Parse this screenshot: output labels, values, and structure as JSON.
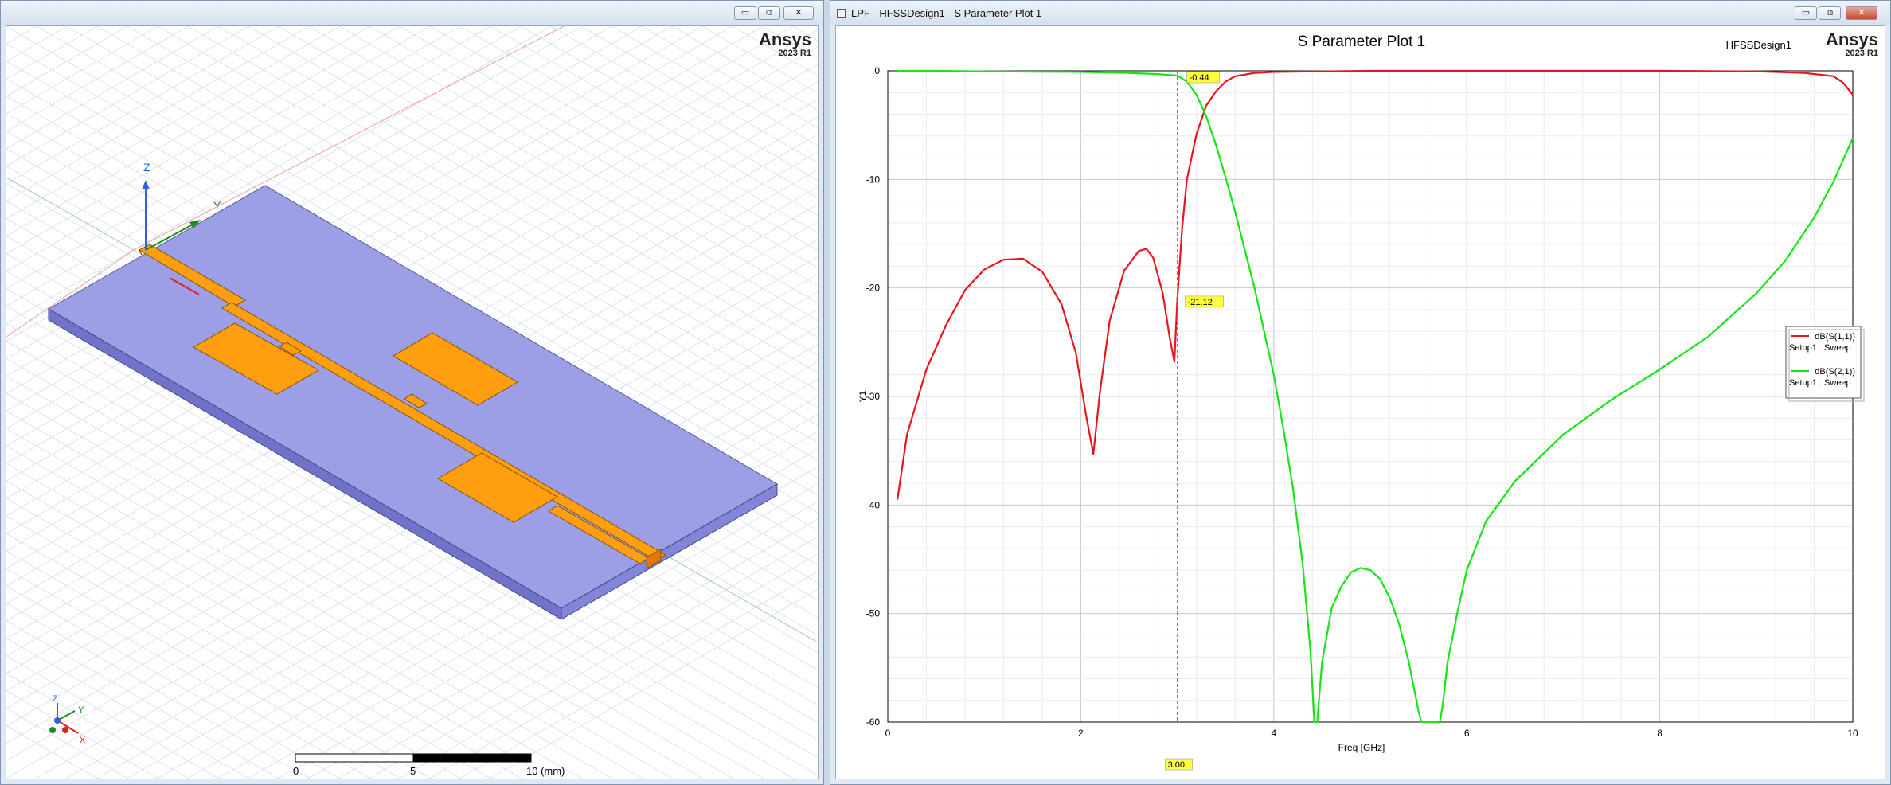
{
  "left_window": {
    "controls": {
      "minimize": "▭",
      "restore": "⧉",
      "close": "✕"
    },
    "logo": {
      "name": "Ansys",
      "version": "2023 R1"
    },
    "axes": {
      "z": "Z",
      "y": "Y"
    },
    "mini_axes": {
      "z": "Z",
      "y": "Y",
      "x": "X"
    },
    "scale_bar": {
      "tick0": "0",
      "tick1": "5",
      "tick2": "10 (mm)"
    },
    "colors": {
      "substrate": "#9c9ee6",
      "metal": "#ff9f10",
      "grid": "#dfe3ea"
    }
  },
  "right_window": {
    "title": "LPF - HFSSDesign1 - S Parameter Plot 1",
    "controls": {
      "minimize": "▭",
      "restore": "⧉",
      "close": "✕"
    },
    "logo": {
      "name": "Ansys",
      "version": "2023 R1"
    },
    "design_label": "HFSSDesign1",
    "marker_labels": {
      "x": "3.00",
      "m1": "-0.44",
      "m2": "-21.12"
    },
    "legend": [
      {
        "name": "dB(S(1,1))",
        "sub": "Setup1 : Sweep",
        "color": "#e8141e"
      },
      {
        "name": "dB(S(2,1))",
        "sub": "Setup1 : Sweep",
        "color": "#14e614"
      }
    ]
  },
  "chart_data": {
    "type": "line",
    "title": "S Parameter Plot 1",
    "xlabel": "Freq [GHz]",
    "ylabel": "Y1",
    "xlim": [
      0,
      10
    ],
    "ylim": [
      -60,
      0
    ],
    "x_ticks": [
      "0",
      "2",
      "4",
      "6",
      "8",
      "10"
    ],
    "y_ticks": [
      "0",
      "-10",
      "-20",
      "-30",
      "-40",
      "-50",
      "-60"
    ],
    "grid": true,
    "legend_position": "right",
    "marker_freq": 3.0,
    "series": [
      {
        "name": "dB(S(1,1))",
        "color": "#e8141e",
        "x": [
          0.1,
          0.2,
          0.4,
          0.6,
          0.8,
          1.0,
          1.2,
          1.4,
          1.6,
          1.8,
          1.95,
          2.05,
          2.13,
          2.2,
          2.3,
          2.45,
          2.6,
          2.68,
          2.75,
          2.85,
          2.92,
          2.97,
          3.0,
          3.05,
          3.1,
          3.2,
          3.3,
          3.4,
          3.5,
          3.6,
          3.8,
          4.0,
          5.0,
          6.0,
          7.0,
          8.0,
          9.0,
          9.5,
          9.8,
          9.9,
          10.0
        ],
        "y": [
          -39.5,
          -33.5,
          -27.5,
          -23.5,
          -20.2,
          -18.3,
          -17.4,
          -17.3,
          -18.5,
          -21.5,
          -26.0,
          -31.5,
          -35.3,
          -29.5,
          -23.0,
          -18.4,
          -16.6,
          -16.4,
          -17.2,
          -20.5,
          -24.5,
          -26.8,
          -21.1,
          -14.5,
          -10.0,
          -5.8,
          -3.2,
          -1.9,
          -1.0,
          -0.5,
          -0.2,
          -0.1,
          0,
          0,
          0,
          0,
          -0.05,
          -0.2,
          -0.5,
          -1.1,
          -2.2
        ]
      },
      {
        "name": "dB(S(2,1))",
        "color": "#14e614",
        "x": [
          0.1,
          0.5,
          1.0,
          1.5,
          2.0,
          2.5,
          2.8,
          3.0,
          3.1,
          3.2,
          3.3,
          3.4,
          3.5,
          3.6,
          3.8,
          4.0,
          4.1,
          4.2,
          4.3,
          4.38,
          4.42,
          4.45,
          4.5,
          4.6,
          4.7,
          4.8,
          4.9,
          5.0,
          5.1,
          5.2,
          5.3,
          5.4,
          5.5,
          5.53,
          5.72,
          5.75,
          5.8,
          5.9,
          6.0,
          6.2,
          6.5,
          7.0,
          7.5,
          8.0,
          8.5,
          9.0,
          9.3,
          9.6,
          9.8,
          10.0
        ],
        "y": [
          0,
          0,
          -0.05,
          -0.08,
          -0.1,
          -0.2,
          -0.3,
          -0.44,
          -1.0,
          -2.2,
          -4.2,
          -6.8,
          -9.8,
          -13.0,
          -20.0,
          -28.0,
          -33.0,
          -38.5,
          -45.5,
          -53.5,
          -60,
          -60,
          -54.5,
          -49.5,
          -47.5,
          -46.2,
          -45.8,
          -46.0,
          -46.8,
          -48.5,
          -51.0,
          -54.5,
          -59.0,
          -60,
          -60,
          -58.5,
          -54.5,
          -50.0,
          -46.0,
          -41.5,
          -37.8,
          -33.5,
          -30.3,
          -27.5,
          -24.5,
          -20.5,
          -17.5,
          -13.5,
          -10.2,
          -6.2
        ]
      }
    ]
  }
}
